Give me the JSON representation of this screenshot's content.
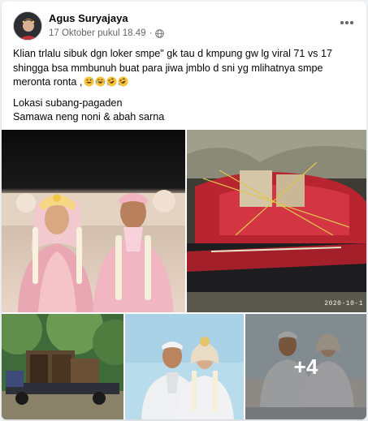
{
  "post": {
    "author": "Agus Suryajaya",
    "timestamp": "17 Oktober pukul 18.49",
    "separator": "·",
    "privacy_icon": "globe-icon",
    "more_icon": "more-options-icon",
    "body_line_1": "Klian trlalu sibuk dgn loker smpe\" gk tau d kmpung gw lg viral 71 vs 17 shingga bsa mmbunuh buat para jiwa jmblo d sni yg mlihatnya smpe meronta ronta ,",
    "emojis": [
      "grinning-sweat-emoji",
      "tears-of-joy-emoji",
      "rolling-laughing-emoji",
      "rolling-laughing-emoji"
    ],
    "body_line_2": "Lokasi subang-pagaden",
    "body_line_3": "Samawa neng noni & abah sarna"
  },
  "photos": {
    "items": [
      {
        "name": "wedding-couple-photo"
      },
      {
        "name": "motorcycle-load-photo",
        "stamp": "2020-10-1"
      },
      {
        "name": "truck-furniture-photo"
      },
      {
        "name": "couple-portrait-photo"
      },
      {
        "name": "couple-selfie-photo",
        "more_count": "+4"
      }
    ]
  },
  "colors": {
    "name_text": "#050505",
    "meta_text": "#65676b",
    "card_bg": "#ffffff",
    "page_bg": "#f0f2f5"
  }
}
